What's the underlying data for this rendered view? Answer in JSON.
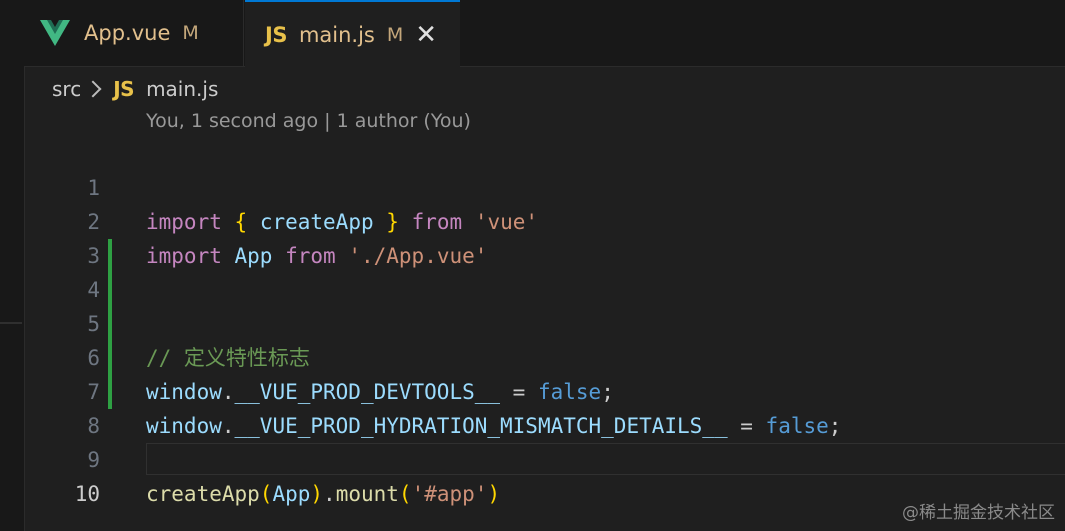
{
  "tabs": {
    "app": {
      "label": "App.vue",
      "modified": "M"
    },
    "main": {
      "label": "main.js",
      "modified": "M",
      "close": "✕",
      "icon_text": "JS"
    }
  },
  "breadcrumb": {
    "folder": "src",
    "icon_text": "JS",
    "file": "main.js"
  },
  "codelens": "You, 1 second ago | 1 author (You)",
  "line_numbers": [
    "1",
    "2",
    "3",
    "4",
    "5",
    "6",
    "7",
    "8",
    "9",
    "10"
  ],
  "code": {
    "l1": {
      "import": "import",
      "brace_open": "{",
      "name": "createApp",
      "brace_close": "}",
      "from": "from",
      "module": "'vue'"
    },
    "l2": {
      "import": "import",
      "name": "App",
      "from": "from",
      "module": "'./App.vue'"
    },
    "l4": {
      "comment": "// 定义特性标志"
    },
    "l5": {
      "obj": "window",
      "dot": ".",
      "prop": "__VUE_PROD_DEVTOOLS__",
      "eq": " = ",
      "value": "false",
      "semi": ";"
    },
    "l6": {
      "obj": "window",
      "dot": ".",
      "prop": "__VUE_PROD_HYDRATION_MISMATCH_DETAILS__",
      "eq": " = ",
      "value": "false",
      "semi": ";"
    },
    "l9": {
      "fn": "createApp",
      "p_open": "(",
      "arg": "App",
      "p_close": ")",
      "dot": ".",
      "method": "mount",
      "p2_open": "(",
      "str": "'#app'",
      "p2_close": ")"
    }
  },
  "watermark": "@稀土掘金技术社区",
  "colors": {
    "keyword": "#c586c0",
    "string": "#ce9178",
    "comment": "#6a9955",
    "boolean": "#569cd6",
    "function": "#dcdcaa",
    "variable": "#9cdcfe",
    "git_added": "#2ea043",
    "tab_active_border": "#0078d4"
  }
}
